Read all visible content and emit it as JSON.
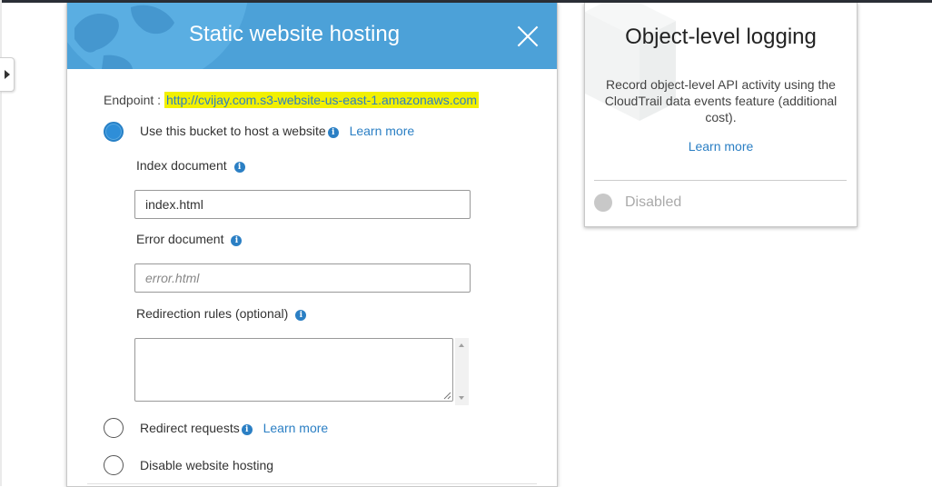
{
  "main_panel": {
    "title": "Static website hosting",
    "endpoint_label": "Endpoint :",
    "endpoint_url": "http://cvijay.com.s3-website-us-east-1.amazonaws.com",
    "options": [
      {
        "label": "Use this bucket to host a website",
        "link": "Learn more",
        "selected": true
      },
      {
        "label": "Redirect requests",
        "link": "Learn more",
        "selected": false
      },
      {
        "label": "Disable website hosting",
        "selected": false
      }
    ],
    "index_document": {
      "label": "Index document",
      "value": "index.html"
    },
    "error_document": {
      "label": "Error document",
      "placeholder": "error.html"
    },
    "redirection_rules": {
      "label": "Redirection rules (optional)",
      "value": ""
    }
  },
  "side_panel": {
    "title": "Object-level logging",
    "description": "Record object-level API activity using the CloudTrail data events feature (additional cost).",
    "link": "Learn more",
    "status": "Disabled"
  },
  "icons": {
    "info": "i",
    "close": "close-icon",
    "toggle": "caret-right-icon"
  },
  "colors": {
    "header_blue": "#4ca1d8",
    "link_blue": "#2b7fc4",
    "radio_selected": "#2e8ed8",
    "highlight": "#f2f000"
  }
}
